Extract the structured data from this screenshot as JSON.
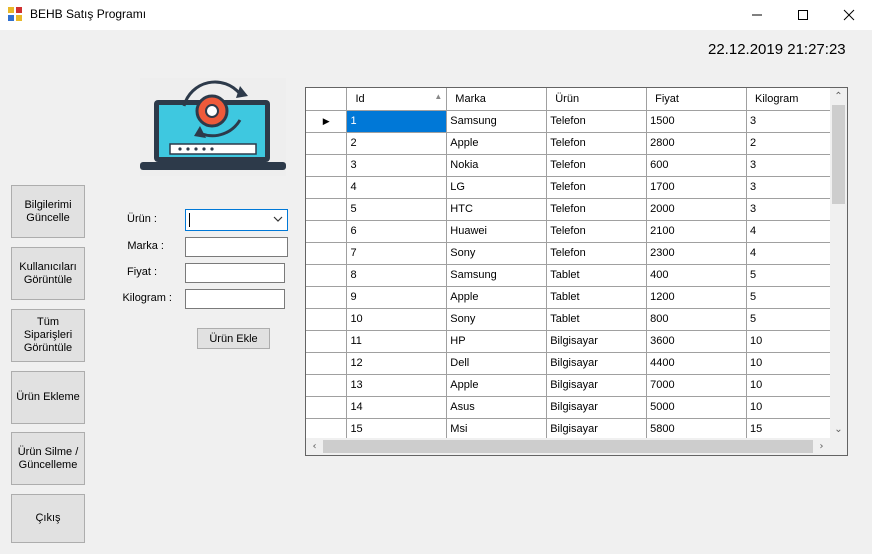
{
  "window": {
    "title": "BEHB Satış Programı",
    "minimize": "—",
    "maximize": "☐",
    "close": "✕"
  },
  "clock": "22.12.2019 21:27:23",
  "sidebar": {
    "btn1": "Bilgilerimi Güncelle",
    "btn2": "Kullanıcıları Görüntüle",
    "btn3": "Tüm Siparişleri Görüntüle",
    "btn4": "Ürün Ekleme",
    "btn5": "Ürün Silme / Güncelleme",
    "btn6": "Çıkış"
  },
  "form": {
    "urun_label": "Ürün :",
    "marka_label": "Marka :",
    "fiyat_label": "Fiyat :",
    "kilogram_label": "Kilogram :",
    "urun_value": "",
    "marka_value": "",
    "fiyat_value": "",
    "kilogram_value": "",
    "add_button": "Ürün Ekle"
  },
  "grid": {
    "columns": [
      "Id",
      "Marka",
      "Ürün",
      "Fiyat",
      "Kilogram"
    ],
    "rows": [
      [
        "1",
        "Samsung",
        "Telefon",
        "1500",
        "3"
      ],
      [
        "2",
        "Apple",
        "Telefon",
        "2800",
        "2"
      ],
      [
        "3",
        "Nokia",
        "Telefon",
        "600",
        "3"
      ],
      [
        "4",
        "LG",
        "Telefon",
        "1700",
        "3"
      ],
      [
        "5",
        "HTC",
        "Telefon",
        "2000",
        "3"
      ],
      [
        "6",
        "Huawei",
        "Telefon",
        "2100",
        "4"
      ],
      [
        "7",
        "Sony",
        "Telefon",
        "2300",
        "4"
      ],
      [
        "8",
        "Samsung",
        "Tablet",
        "400",
        "5"
      ],
      [
        "9",
        "Apple",
        "Tablet",
        "1200",
        "5"
      ],
      [
        "10",
        "Sony",
        "Tablet",
        "800",
        "5"
      ],
      [
        "11",
        "HP",
        "Bilgisayar",
        "3600",
        "10"
      ],
      [
        "12",
        "Dell",
        "Bilgisayar",
        "4400",
        "10"
      ],
      [
        "13",
        "Apple",
        "Bilgisayar",
        "7000",
        "10"
      ],
      [
        "14",
        "Asus",
        "Bilgisayar",
        "5000",
        "10"
      ],
      [
        "15",
        "Msi",
        "Bilgisayar",
        "5800",
        "15"
      ]
    ],
    "selected_row": 0,
    "sorted_column": "Id"
  },
  "colors": {
    "selection": "#0078d7",
    "laptop_screen": "#3ec8e0",
    "laptop_frame": "#2d3a4a",
    "accent_red": "#ee5a3a"
  }
}
